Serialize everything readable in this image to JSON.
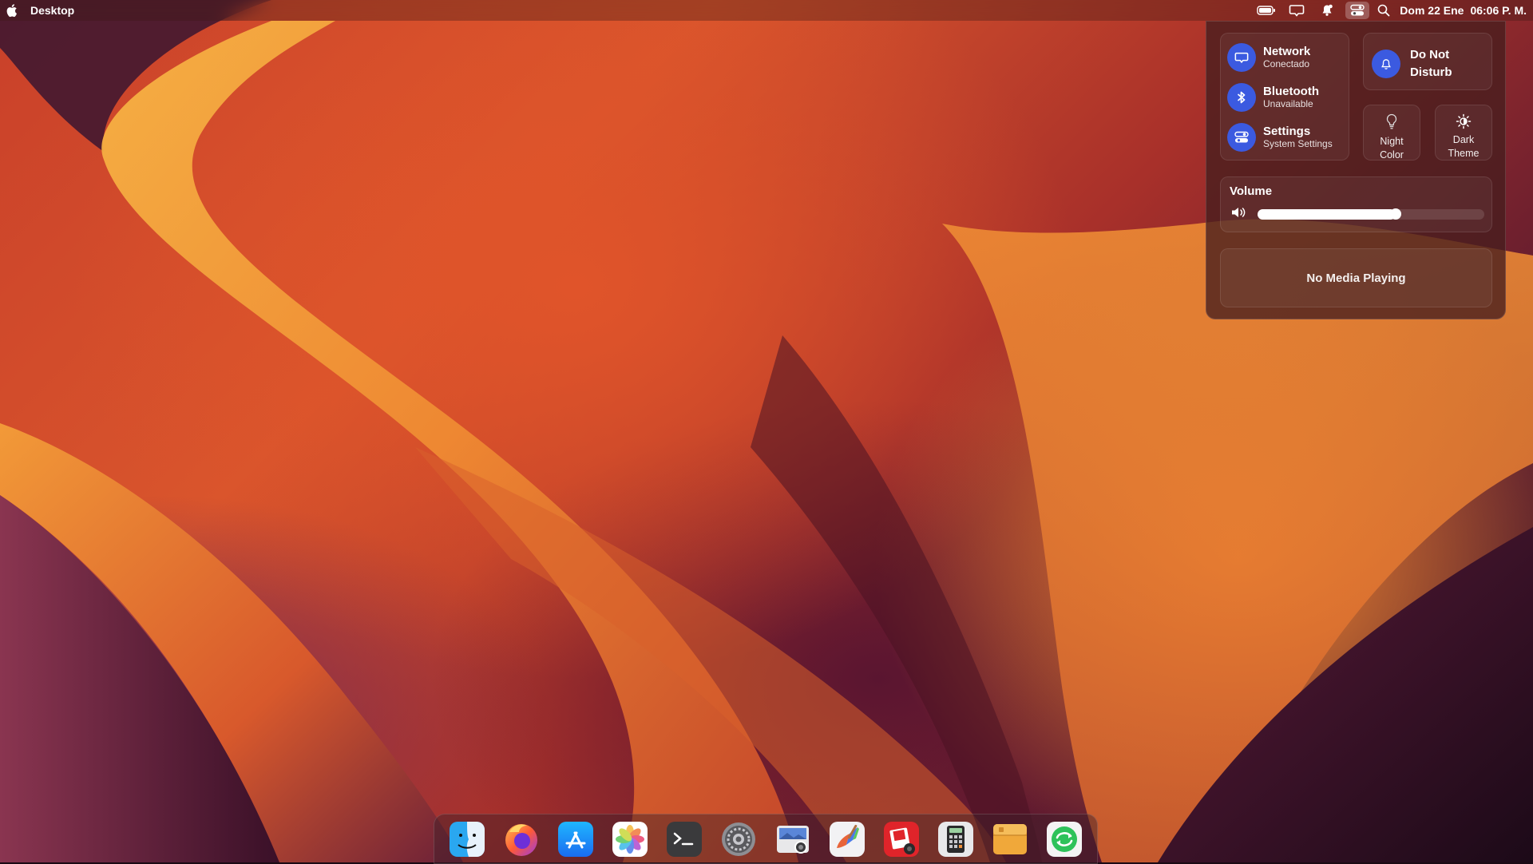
{
  "menubar": {
    "app_title": "Desktop",
    "date": "Dom 22 Ene",
    "time": "06:06 P. M.",
    "icons": [
      "apple-icon",
      "battery-icon",
      "display-icon",
      "notification-bell-icon",
      "control-center-icon",
      "search-icon"
    ]
  },
  "control_center": {
    "network": {
      "label": "Network",
      "status": "Conectado"
    },
    "bluetooth": {
      "label": "Bluetooth",
      "status": "Unavailable"
    },
    "settings": {
      "label": "Settings",
      "status": "System Settings"
    },
    "do_not_disturb": {
      "label": "Do Not Disturb"
    },
    "night_color": {
      "label_line1": "Night",
      "label_line2": "Color"
    },
    "dark_theme": {
      "label_line1": "Dark",
      "label_line2": "Theme"
    },
    "volume": {
      "label": "Volume",
      "level_percent": 61
    },
    "media": {
      "label": "No Media Playing"
    },
    "accent_color": "#3b5ae0"
  },
  "dock": {
    "apps": [
      "finder",
      "firefox",
      "app-store",
      "photos",
      "terminal",
      "system-settings",
      "image-viewer",
      "paint",
      "screen-recorder",
      "calculator",
      "archive",
      "sync"
    ]
  }
}
